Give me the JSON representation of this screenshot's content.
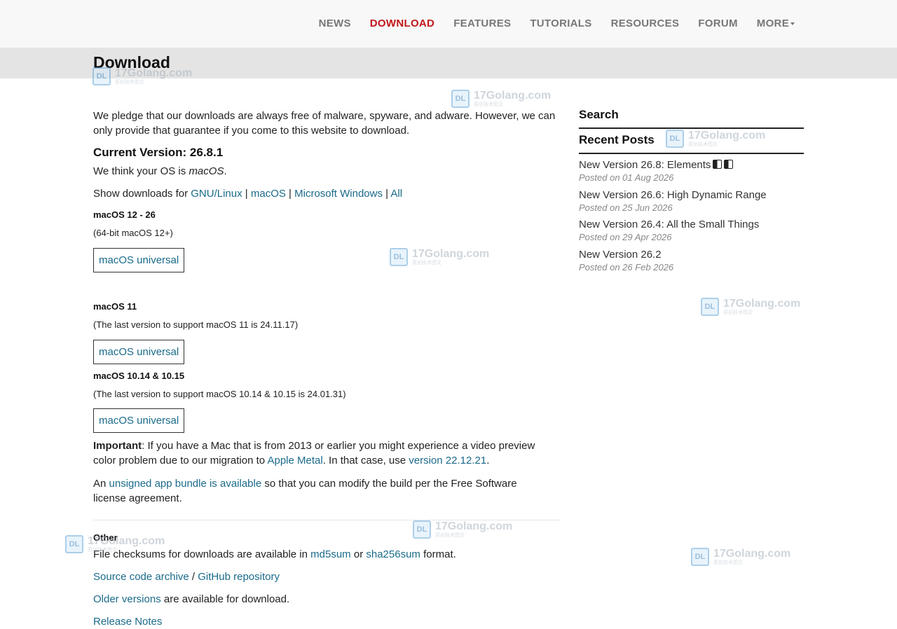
{
  "nav": {
    "items": [
      {
        "label": "NEWS"
      },
      {
        "label": "DOWNLOAD",
        "active": true
      },
      {
        "label": "FEATURES"
      },
      {
        "label": "TUTORIALS"
      },
      {
        "label": "RESOURCES"
      },
      {
        "label": "FORUM"
      },
      {
        "label": "MORE"
      }
    ]
  },
  "page": {
    "title": "Download"
  },
  "main": {
    "pledge": "We pledge that our downloads are always free of malware, spyware, and adware. However, we can only provide that guarantee if you come to this website to download.",
    "current_version": "Current Version: 26.8.1",
    "os_prefix": "We think your OS is ",
    "os_name": "macOS",
    "os_suffix": ".",
    "show_prefix": "Show downloads for ",
    "show_links": [
      "GNU/Linux",
      "macOS",
      "Microsoft Windows",
      "All"
    ],
    "separator": "|",
    "sections": [
      {
        "heading": "macOS 12 - 26",
        "note": "(64-bit macOS 12+)",
        "button": "macOS universal"
      },
      {
        "heading": "macOS 11",
        "note": "(The last version to support macOS 11 is 24.11.17)",
        "button": "macOS universal"
      },
      {
        "heading": "macOS 10.14 & 10.15",
        "note": "(The last version to support macOS 10.14 & 10.15 is 24.01.31)",
        "button": "macOS universal"
      }
    ],
    "important": {
      "label": "Important",
      "text1": ": If you have a Mac that is from 2013 or earlier you might experience a video preview color problem due to our migration to ",
      "link1": "Apple Metal",
      "text2": ". In that case, use ",
      "link2": "version 22.12.21",
      "text3": "."
    },
    "unsigned": {
      "prefix": "An ",
      "link": "unsigned app bundle is available",
      "suffix": " so that you can modify the build per the Free Software license agreement."
    },
    "other": {
      "heading": "Other",
      "checksum_prefix": "File checksums for downloads are available in ",
      "md5": "md5sum",
      "or": " or ",
      "sha": "sha256sum",
      "checksum_suffix": " format.",
      "source_link": "Source code archive",
      "slash": " / ",
      "github_link": "GitHub repository",
      "older_link": "Older versions",
      "older_suffix": " are available for download.",
      "release_notes": "Release Notes"
    }
  },
  "sidebar": {
    "search_heading": "Search",
    "recent_heading": "Recent Posts",
    "posts": [
      {
        "title": "New Version 26.8: Elements",
        "date": "Posted on 01 Aug 2026"
      },
      {
        "title": "New Version 26.6: High Dynamic Range",
        "date": "Posted on 25 Jun 2026"
      },
      {
        "title": "New Version 26.4: All the Small Things",
        "date": "Posted on 29 Apr 2026"
      },
      {
        "title": "New Version 26.2",
        "date": "Posted on 26 Feb 2026"
      }
    ]
  },
  "watermark": {
    "text": "17Golang.com",
    "sub": "原创技术图文",
    "icon": "dl-logo-icon"
  }
}
